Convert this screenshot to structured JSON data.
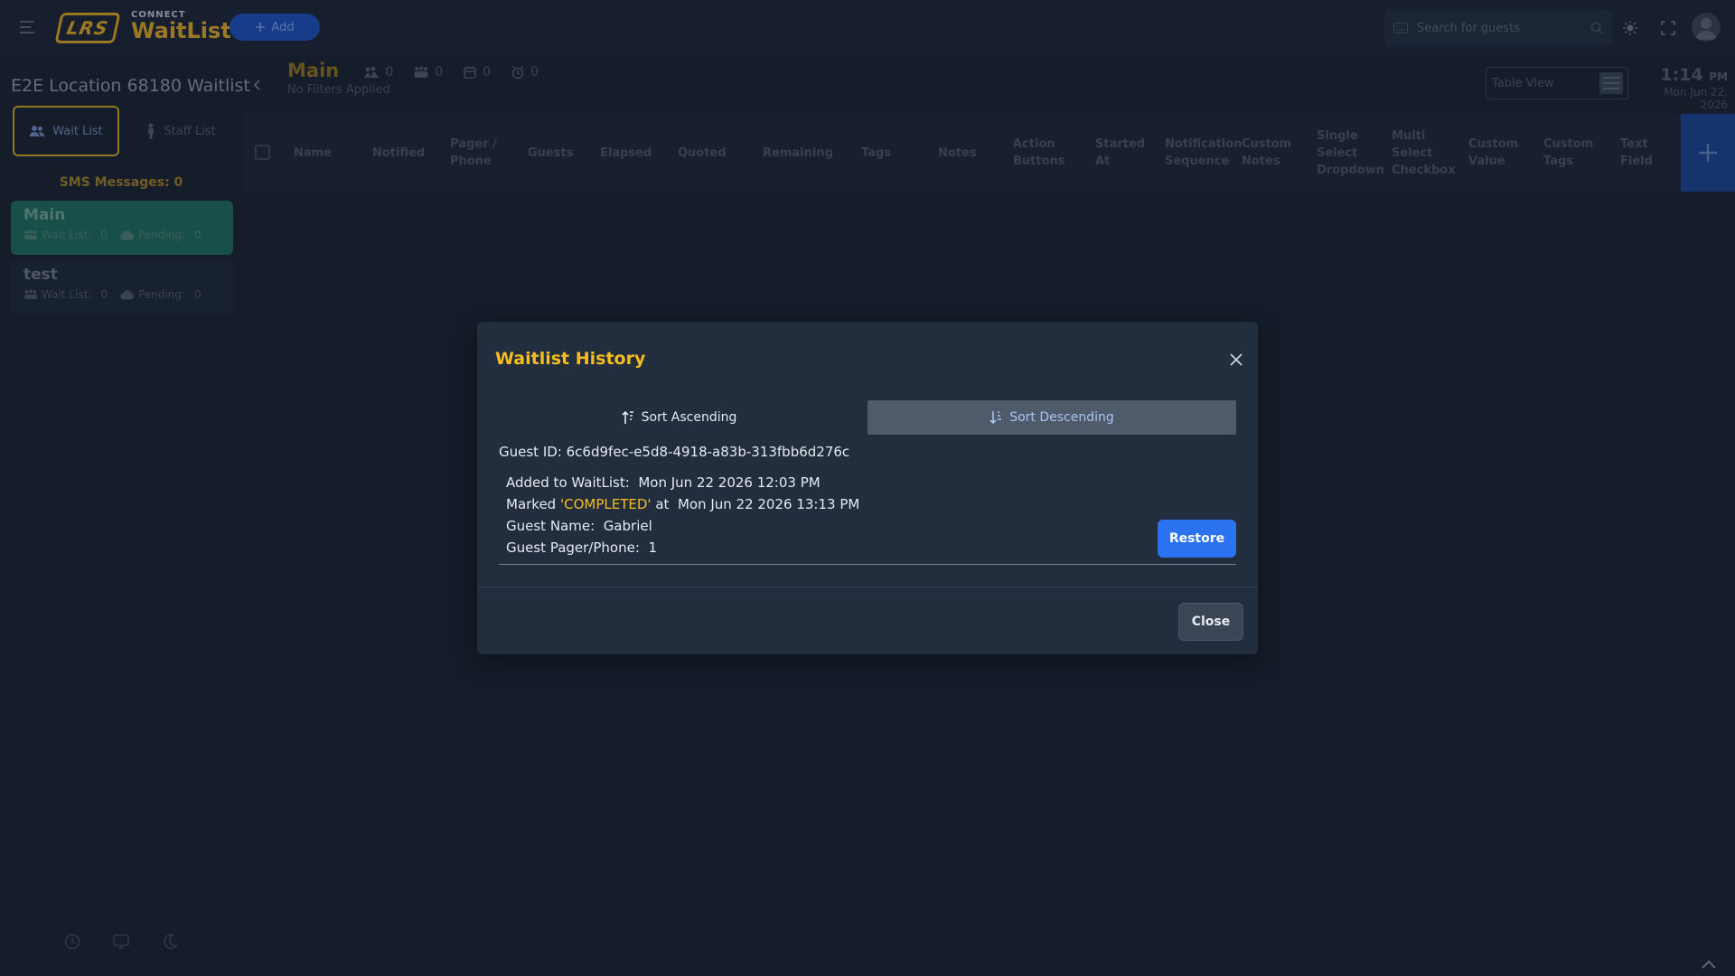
{
  "header": {
    "logo_text": "LRS",
    "brand_small": "CONNECT",
    "brand_big": "WaitList",
    "add_label": "Add",
    "search_placeholder": "Search for guests"
  },
  "sidebar": {
    "location_title": "E2E Location 68180 Waitlist",
    "tabs": [
      {
        "label": "Wait List",
        "active": true
      },
      {
        "label": "Staff List",
        "active": false
      }
    ],
    "sms_label": "SMS Messages: 0",
    "lists": [
      {
        "name": "Main",
        "waitlist_label": "Wait List:",
        "waitlist_count": "0",
        "pending_label": "Pending:",
        "pending_count": "0",
        "active": true
      },
      {
        "name": "test",
        "waitlist_label": "Wait List:",
        "waitlist_count": "0",
        "pending_label": "Pending:",
        "pending_count": "0",
        "active": false
      }
    ]
  },
  "main": {
    "title": "Main",
    "stats": [
      {
        "icon": "crowd-icon",
        "value": "0"
      },
      {
        "icon": "group-icon",
        "value": "0"
      },
      {
        "icon": "calendar-icon",
        "value": "0"
      },
      {
        "icon": "alarm-icon",
        "value": "0"
      }
    ],
    "filters_label": "No Filters Applied",
    "table_view_label": "Table View",
    "clock_time": "1:14",
    "clock_ampm": "PM",
    "clock_date": "Mon Jun 22, 2026",
    "columns": [
      [
        "Name"
      ],
      [
        "Notified"
      ],
      [
        "Pager /",
        "Phone"
      ],
      [
        "Guests"
      ],
      [
        "Elapsed"
      ],
      [
        "Quoted"
      ],
      [
        "Remaining"
      ],
      [
        "Tags"
      ],
      [
        "Notes"
      ],
      [
        "Action",
        "Buttons"
      ],
      [
        "Started",
        "At"
      ],
      [
        "Notification",
        "Sequence"
      ],
      [
        "Custom",
        "Notes"
      ],
      [
        "Single",
        "Select",
        "Dropdown"
      ],
      [
        "Multi",
        "Select",
        "Checkbox"
      ],
      [
        "Custom",
        "Value"
      ],
      [
        "Custom",
        "Tags"
      ],
      [
        "Text",
        "Field"
      ]
    ]
  },
  "modal": {
    "title": "Waitlist History",
    "sort_ascending": "Sort Ascending",
    "sort_descending": "Sort Descending",
    "guest_id_label": "Guest ID:",
    "guest_id_value": "6c6d9fec-e5d8-4918-a83b-313fbb6d276c",
    "added_label": "Added to WaitList:",
    "added_value": "Mon Jun 22 2026 12:03 PM",
    "marked_label": "Marked",
    "marked_status": "'COMPLETED'",
    "marked_at": "at",
    "marked_value": "Mon Jun 22 2026 13:13 PM",
    "guest_name_label": "Guest Name:",
    "guest_name_value": "Gabriel",
    "guest_phone_label": "Guest Pager/Phone:",
    "guest_phone_value": "1",
    "restore_label": "Restore",
    "close_label": "Close"
  },
  "colors": {
    "accent_gold": "#f5be1e",
    "primary_blue": "#2b72f0",
    "active_list_green": "#1f6a5e",
    "background": "#1b2433"
  }
}
